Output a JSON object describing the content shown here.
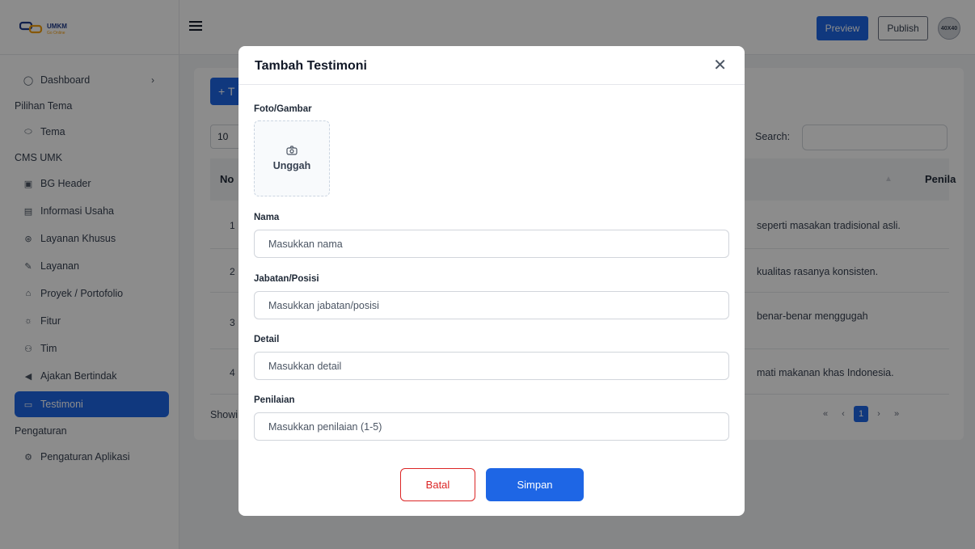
{
  "logo": {
    "name": "UMKM",
    "sub": "Go Online"
  },
  "sidebar": {
    "dashboard": "Dashboard",
    "section_tema": "Pilihan Tema",
    "tema": "Tema",
    "section_cms": "CMS UMK",
    "items": [
      "BG Header",
      "Informasi Usaha",
      "Layanan Khusus",
      "Layanan",
      "Proyek / Portofolio",
      "Fitur",
      "Tim",
      "Ajakan Bertindak",
      "Testimoni"
    ],
    "section_settings": "Pengaturan",
    "settings_item": "Pengaturan Aplikasi"
  },
  "header": {
    "preview": "Preview",
    "publish": "Publish",
    "avatar": "40X40"
  },
  "table": {
    "add_label": "+ T",
    "page_length": "10",
    "search_label": "Search:",
    "col_no": "No",
    "col_rating": "Penila",
    "rows": [
      {
        "no": "1",
        "text": "seperti masakan tradisional asli."
      },
      {
        "no": "2",
        "text": "kualitas rasanya konsisten."
      },
      {
        "no": "3",
        "text": "benar-benar menggugah"
      },
      {
        "no": "4",
        "text": "mati makanan khas Indonesia."
      }
    ],
    "showing": "Showi",
    "pager": [
      "«",
      "‹",
      "1",
      "›",
      "»"
    ]
  },
  "modal": {
    "title": "Tambah Testimoni",
    "photo_label": "Foto/Gambar",
    "upload_label": "Unggah",
    "name_label": "Nama",
    "name_placeholder": "Masukkan nama",
    "position_label": "Jabatan/Posisi",
    "position_placeholder": "Masukkan jabatan/posisi",
    "detail_label": "Detail",
    "detail_placeholder": "Masukkan detail",
    "rating_label": "Penilaian",
    "rating_placeholder": "Masukkan penilaian (1-5)",
    "cancel": "Batal",
    "save": "Simpan"
  },
  "colors": {
    "primary": "#1e66e5",
    "danger": "#dc2626"
  }
}
